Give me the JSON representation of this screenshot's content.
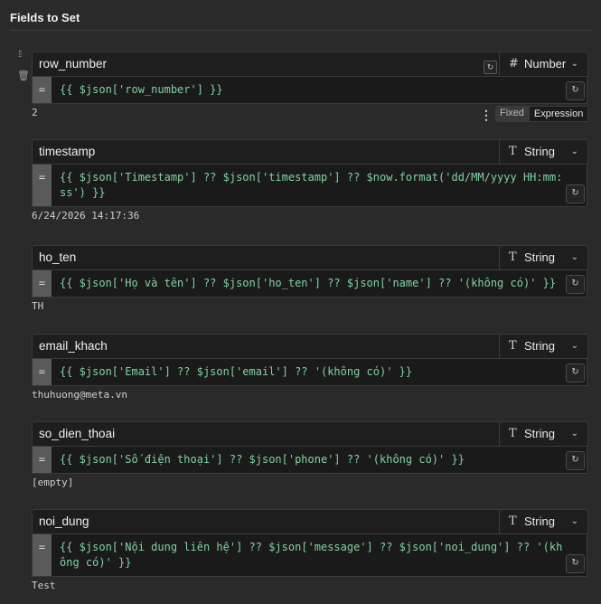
{
  "section": {
    "title": "Fields to Set"
  },
  "mode": {
    "fixed": "Fixed",
    "expression": "Expression"
  },
  "fields": [
    {
      "name": "row_number",
      "type_icon": "#",
      "type": "Number",
      "expression": "{{ $json['row_number'] }}",
      "result": "2"
    },
    {
      "name": "timestamp",
      "type_icon": "T",
      "type": "String",
      "expression": "{{ $json['Timestamp'] ?? $json['timestamp'] ?? $now.format('dd/MM/yyyy HH:mm:ss') }}",
      "result": "6/24/2026 14:17:36"
    },
    {
      "name": "ho_ten",
      "type_icon": "T",
      "type": "String",
      "expression": "{{ $json['Họ và tên'] ?? $json['ho_ten'] ?? $json['name'] ?? '(không có)' }}",
      "result": "TH"
    },
    {
      "name": "email_khach",
      "type_icon": "T",
      "type": "String",
      "expression": "{{ $json['Email'] ?? $json['email'] ?? '(không có)' }}",
      "result": "thuhuong@meta.vn"
    },
    {
      "name": "so_dien_thoai",
      "type_icon": "T",
      "type": "String",
      "expression": "{{ $json['Số điện thoại'] ?? $json['phone'] ?? '(không có)' }}",
      "result": "[empty]"
    },
    {
      "name": "noi_dung",
      "type_icon": "T",
      "type": "String",
      "expression": "{{ $json['Nội dung liên hệ'] ?? $json['message'] ?? $json['noi_dung'] ?? '(không có)' }}",
      "result": "Test"
    }
  ]
}
